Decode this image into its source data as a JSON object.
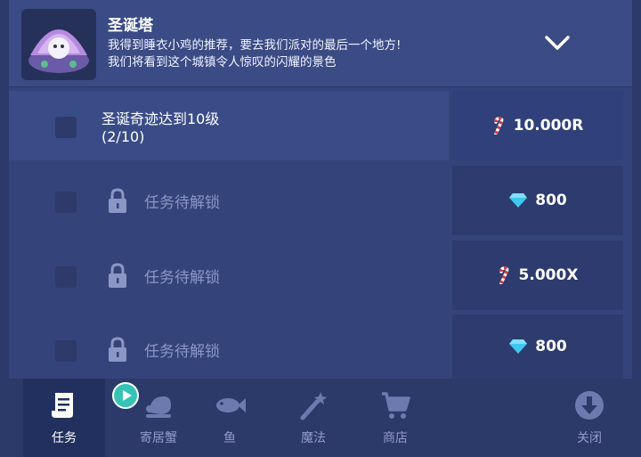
{
  "quest": {
    "title": "圣诞塔",
    "description_line1": "我得到睡衣小鸡的推荐，要去我们派对的最后一个地方!",
    "description_line2": "我们将看到这个城镇令人惊叹的闪耀的景色"
  },
  "tasks": [
    {
      "title": "圣诞奇迹达到10级",
      "progress": "(2/10)",
      "reward_icon": "candy-cane-icon",
      "reward": "10.000R"
    },
    {
      "locked_text": "任务待解锁",
      "reward_icon": "diamond-icon",
      "reward": "800"
    },
    {
      "locked_text": "任务待解锁",
      "reward_icon": "candy-cane-icon",
      "reward": "5.000X"
    },
    {
      "locked_text": "任务待解锁",
      "reward_icon": "diamond-icon",
      "reward": "800"
    }
  ],
  "nav": {
    "tasks": "任务",
    "hermit_crab": "寄居蟹",
    "fish": "鱼",
    "magic": "魔法",
    "shop": "商店",
    "close": "关闭"
  },
  "colors": {
    "background": "#2b3a6b",
    "accent": "#36c3b6",
    "diamond": "#3ec8f0"
  }
}
